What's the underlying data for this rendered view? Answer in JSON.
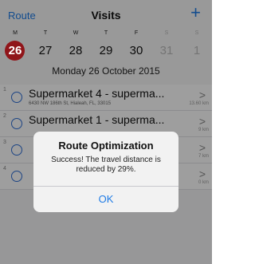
{
  "navbar": {
    "left_label": "Route",
    "title": "Visits",
    "add_label": "+"
  },
  "week": {
    "days": [
      "M",
      "T",
      "W",
      "T",
      "F",
      "S",
      "S"
    ],
    "dates": [
      "26",
      "27",
      "28",
      "29",
      "30",
      "31",
      "1"
    ],
    "selected_date": "Monday  26 October 2015"
  },
  "visits": [
    {
      "num": "1",
      "name": "Supermarket 4 - superma...",
      "address": "6430 NW 186th St, Hialeah, FL, 33015",
      "distance": "13.60 km"
    },
    {
      "num": "2",
      "name": "Supermarket 1 - superma...",
      "address": "",
      "distance": "9 km"
    },
    {
      "num": "3",
      "name": "",
      "address": "",
      "distance": "7 km"
    },
    {
      "num": "4",
      "name": "",
      "address": "",
      "distance": "0 km"
    }
  ],
  "alert": {
    "title": "Route Optimization",
    "message": "Success! The travel distance is reduced by 29%.",
    "ok_label": "OK"
  },
  "colors": {
    "accent": "#1e7be6",
    "selected": "#e8232a"
  }
}
